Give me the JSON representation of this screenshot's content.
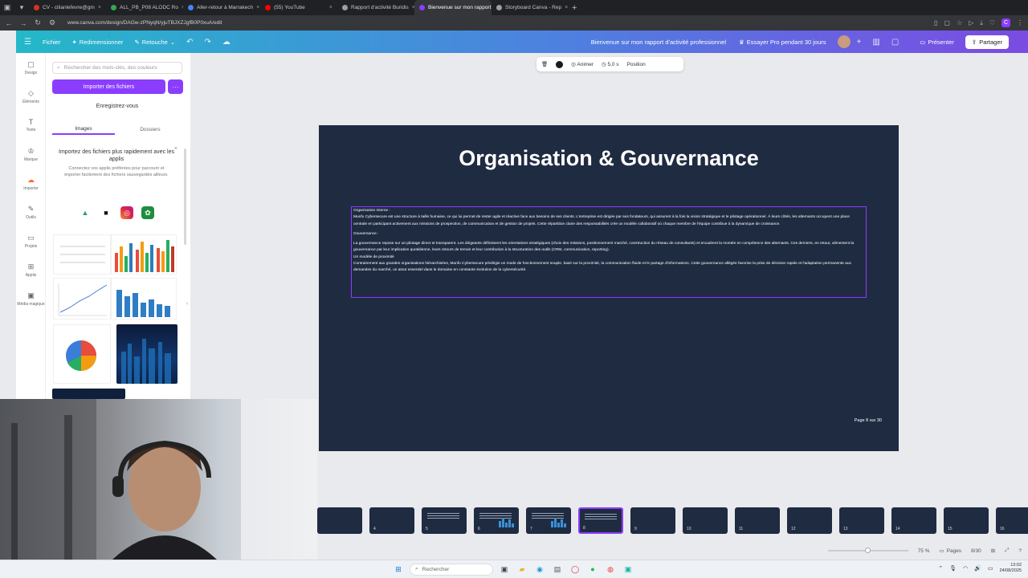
{
  "browser": {
    "tabs": [
      {
        "label": "CV - cilianlefevre@gm",
        "color": "#d93025",
        "active": false
      },
      {
        "label": "ALL_PB_P08 ALODC Ro",
        "color": "#34a853",
        "active": false
      },
      {
        "label": "Aller-retour à Marrakech",
        "color": "#4285f4",
        "active": false
      },
      {
        "label": "(55) YouTube",
        "color": "#ff0000",
        "active": false
      },
      {
        "label": "Rapport d'activité Buridis",
        "color": "#9aa0a6",
        "active": false
      },
      {
        "label": "Bienvenue sur mon rapport",
        "color": "#8b3dff",
        "active": true
      },
      {
        "label": "Storyboard Canva - Rep",
        "color": "#9aa0a6",
        "active": false
      }
    ],
    "new_tab": "+",
    "url": "www.canva.com/design/DAGw-zPNyqN/yjuTBJXZJgfB0P0xuA/edit",
    "extension_badge": "C"
  },
  "header": {
    "file": "Fichier",
    "resize": "Redimensionner",
    "edit": "Retouche",
    "doc_title": "Bienvenue sur mon rapport d'activité professionnel",
    "pro_cta": "Essayer Pro pendant 30 jours",
    "present": "Présenter",
    "share": "Partager"
  },
  "rail": [
    {
      "icon": "design-icon",
      "glyph": "▢",
      "label": "Design"
    },
    {
      "icon": "elements-icon",
      "glyph": "◇",
      "label": "Éléments"
    },
    {
      "icon": "text-icon",
      "glyph": "T",
      "label": "Texte"
    },
    {
      "icon": "brand-icon",
      "glyph": "♔",
      "label": "Marque"
    },
    {
      "icon": "upload-icon",
      "glyph": "☁",
      "label": "Importer"
    },
    {
      "icon": "draw-icon",
      "glyph": "✎",
      "label": "Outils"
    },
    {
      "icon": "projects-icon",
      "glyph": "▭",
      "label": "Projets"
    },
    {
      "icon": "apps-icon",
      "glyph": "⊞",
      "label": "Applis"
    },
    {
      "icon": "media-icon",
      "glyph": "▣",
      "label": "Média magique"
    }
  ],
  "panel": {
    "search_placeholder": "Rechercher des mots-clés, des couleurs",
    "import_button": "Importer des fichiers",
    "more_button": "···",
    "record_button": "Enregistrez-vous",
    "tabs": [
      "Images",
      "Dossiers"
    ],
    "promo_title": "Importez des fichiers plus rapidement avec les applis",
    "promo_body": "Connectez vos applis préférées pour parcourir et importer facilement des fichiers sauvegardés ailleurs.",
    "promo_close": "×"
  },
  "toolbar": {
    "animate": "Animer",
    "duration": "5,0 s",
    "position": "Position"
  },
  "slide": {
    "title": "Organisation & Gouvernance",
    "paragraphs": [
      "Organisation interne :",
      "Munfu Cybersecure est une structure à taille humaine, ce qui lui permet de rester agile et réactive face aux besoins de ses clients. L'entreprise est dirigée par ses fondateurs, qui assurent à la fois la vision stratégique et le pilotage opérationnel. À leurs côtés, les alternants occupent une place centrale en participant activement aux missions de prospection, de communication et de gestion de projets. Cette répartition claire des responsabilités crée un modèle collaboratif où chaque membre de l'équipe contribue à la dynamique de croissance.",
      "Gouvernance :",
      "La gouvernance repose sur un pilotage direct et transparent. Les dirigeants définissent les orientations stratégiques (choix des missions, positionnement marché, construction du réseau de consultants) et encadrent la montée en compétence des alternants. Ces derniers, en retour, alimentent la gouvernance par leur implication quotidienne, leurs retours de terrain et leur contribution à la structuration des outils (CRM, communication, reporting).",
      "Un modèle de proximité",
      "Contrairement aux grandes organisations hiérarchisées, Munfu Cybersecure privilégie un mode de fonctionnement souple, basé sur la proximité, la communication fluide et le partage d'informations. Cette gouvernance allégée favorise la prise de décision rapide et l'adaptation permanente aux demandes du marché, un atout essentiel dans le domaine en constante évolution de la cybersécurité."
    ],
    "page_label": "Page 8 sur 30"
  },
  "filmstrip": {
    "pages": [
      "",
      "4",
      "5",
      "6",
      "7",
      "8",
      "9",
      "10",
      "11",
      "12",
      "13",
      "14",
      "15",
      "16"
    ],
    "active_index": 5
  },
  "status": {
    "zoom": "75 %",
    "zoom_fraction": 0.5,
    "pages_button": "Pages",
    "page_count": "8/30"
  },
  "taskbar": {
    "search_placeholder": "Rechercher",
    "time": "13:02",
    "date": "24/08/2025"
  }
}
